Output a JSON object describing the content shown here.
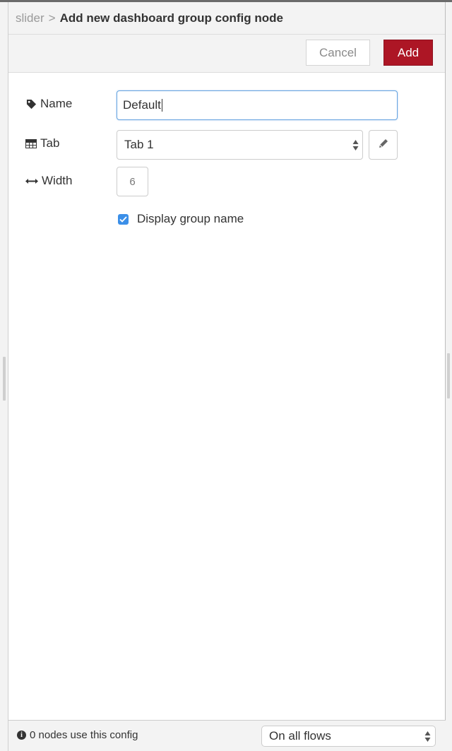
{
  "breadcrumb": {
    "parent": "slider",
    "separator": ">",
    "title": "Add new dashboard group config node"
  },
  "toolbar": {
    "cancel_label": "Cancel",
    "add_label": "Add",
    "add_color": "#ad1625"
  },
  "form": {
    "name": {
      "label": "Name",
      "icon": "tag-icon",
      "value": "Default"
    },
    "tab": {
      "label": "Tab",
      "icon": "table-icon",
      "value": "Tab 1",
      "edit_icon": "pencil-icon"
    },
    "width": {
      "label": "Width",
      "icon": "arrows-h-icon",
      "value": "6"
    },
    "display_group_name": {
      "label": "Display group name",
      "checked": true
    }
  },
  "footer": {
    "info_icon": "info-circle-icon",
    "usage_text": "0 nodes use this config",
    "scope_value": "On all flows"
  }
}
